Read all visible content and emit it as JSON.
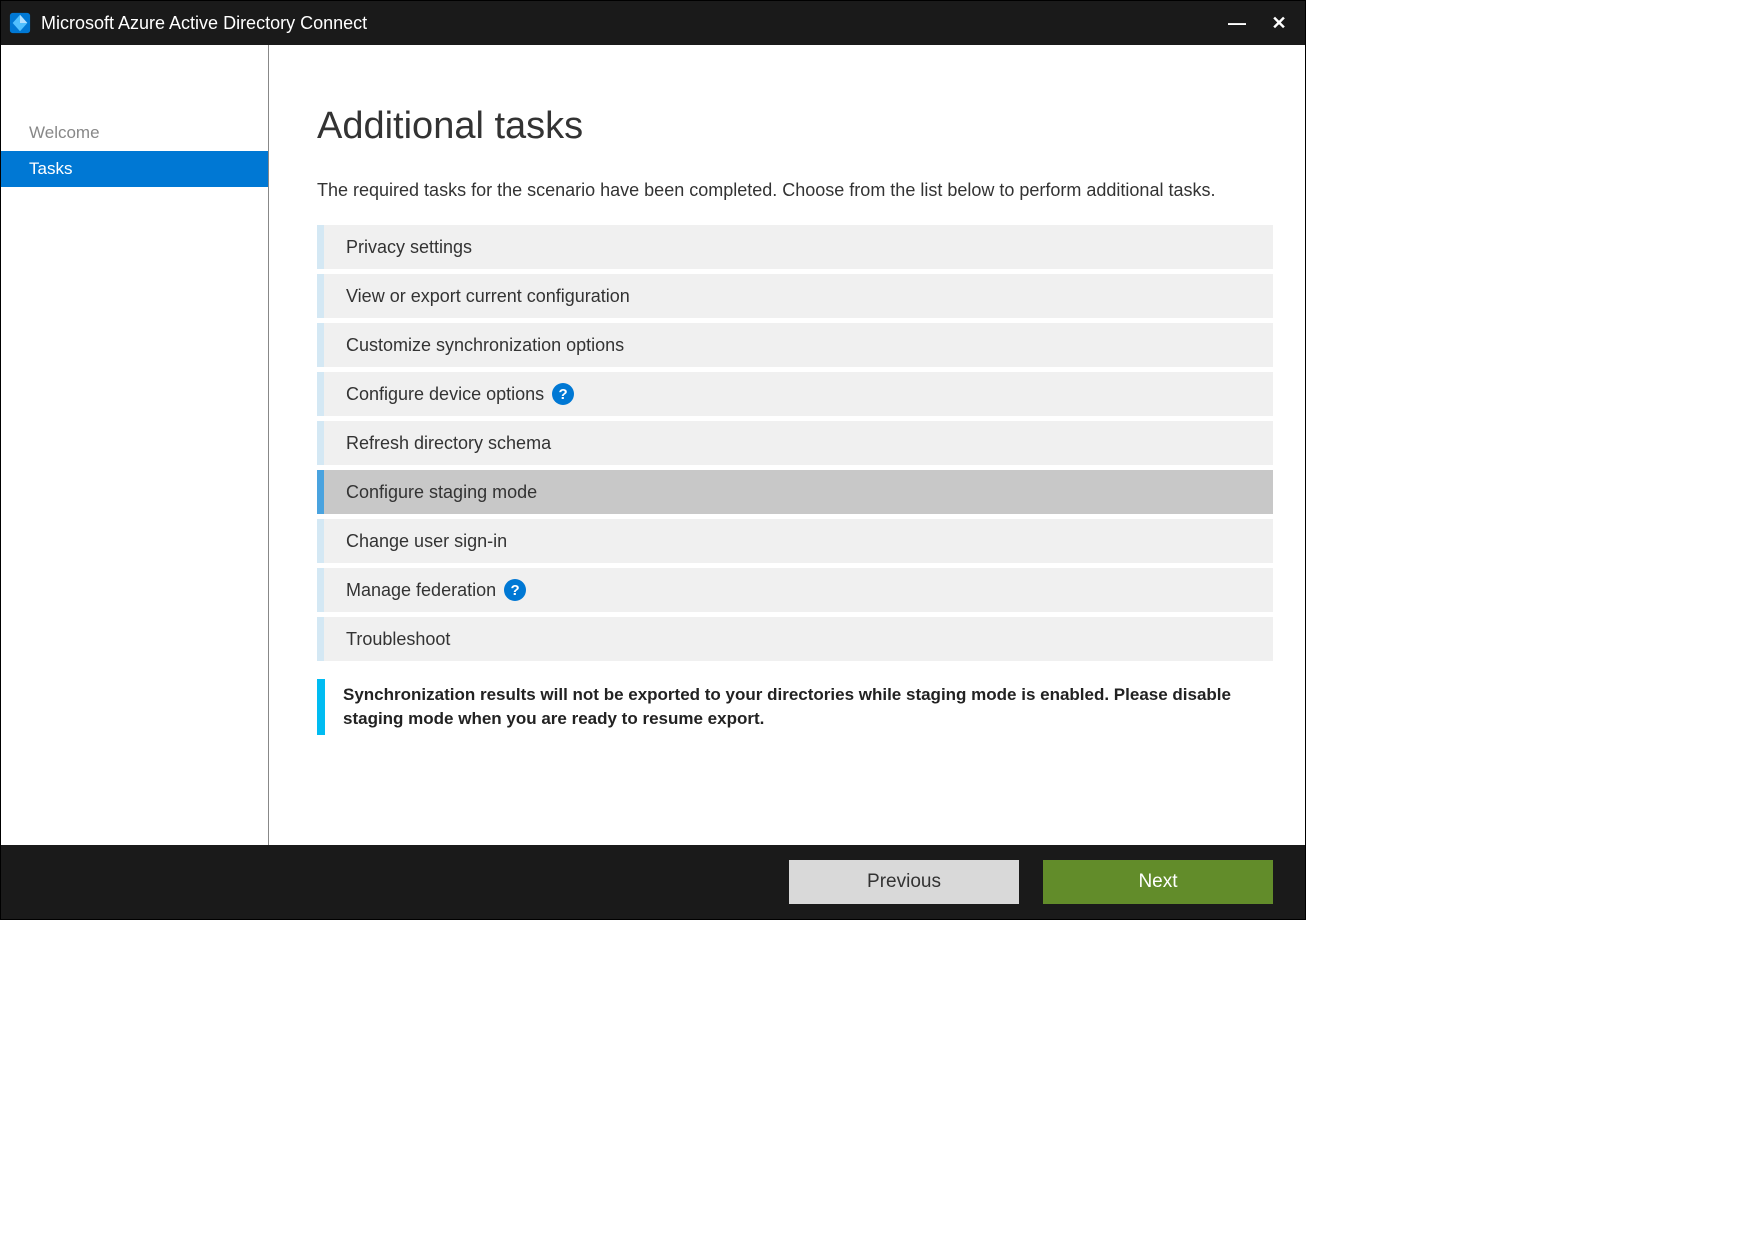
{
  "window": {
    "title": "Microsoft Azure Active Directory Connect"
  },
  "sidebar": {
    "items": [
      {
        "label": "Welcome",
        "state": "inactive"
      },
      {
        "label": "Tasks",
        "state": "active"
      }
    ]
  },
  "main": {
    "title": "Additional tasks",
    "description": "The required tasks for the scenario have been completed. Choose from the list below to perform additional tasks.",
    "tasks": [
      {
        "label": "Privacy settings",
        "help": false,
        "selected": false
      },
      {
        "label": "View or export current configuration",
        "help": false,
        "selected": false
      },
      {
        "label": "Customize synchronization options",
        "help": false,
        "selected": false
      },
      {
        "label": "Configure device options",
        "help": true,
        "selected": false
      },
      {
        "label": "Refresh directory schema",
        "help": false,
        "selected": false
      },
      {
        "label": "Configure staging mode",
        "help": false,
        "selected": true
      },
      {
        "label": "Change user sign-in",
        "help": false,
        "selected": false
      },
      {
        "label": "Manage federation",
        "help": true,
        "selected": false
      },
      {
        "label": "Troubleshoot",
        "help": false,
        "selected": false
      }
    ],
    "note": "Synchronization results will not be exported to your directories while staging mode is enabled. Please disable staging mode when you are ready to resume export."
  },
  "footer": {
    "previous": "Previous",
    "next": "Next"
  },
  "helpGlyph": "?"
}
